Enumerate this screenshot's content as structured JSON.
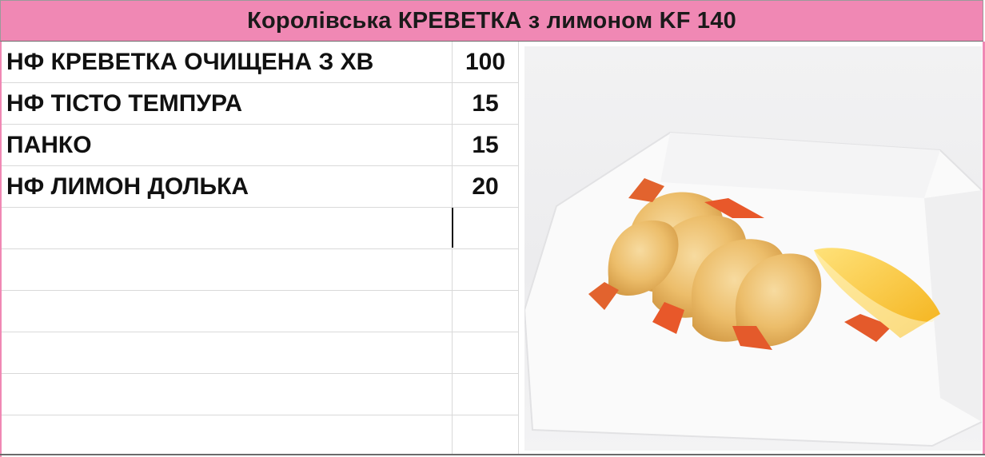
{
  "title": "Королівська КРЕВЕТКА з лимоном KF 140",
  "ingredients": [
    {
      "name": "НФ КРЕВЕТКА ОЧИЩЕНА З ХВ",
      "qty": "100"
    },
    {
      "name": "НФ ТІСТО ТЕМПУРА",
      "qty": "15"
    },
    {
      "name": "ПАНКО",
      "qty": "15"
    },
    {
      "name": "НФ ЛИМОН ДОЛЬКА",
      "qty": "20"
    }
  ],
  "colors": {
    "header_bg": "#f088b4",
    "grid_line": "#d9d9d9",
    "text": "#111111"
  },
  "photo_icon": "fried-shrimp-with-lemon-photo"
}
